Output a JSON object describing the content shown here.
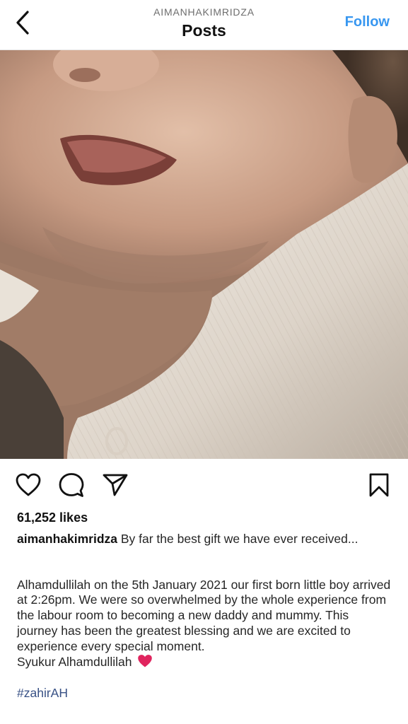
{
  "header": {
    "username": "AIMANHAKIMRIDZA",
    "title": "Posts",
    "follow_label": "Follow"
  },
  "icons": {
    "back": "chevron-left-icon",
    "like": "heart-outline-icon",
    "comment": "comment-bubble-icon",
    "share": "paper-plane-icon",
    "save": "bookmark-icon"
  },
  "post": {
    "image_alt": "Close-up of a smiling newborn baby wearing a white ribbed onesie",
    "likes": "61,252 likes",
    "caption_username": "aimanhakimridza",
    "caption_first": " By far the best gift we have ever received...",
    "caption_paragraph": " Alhamdullilah on the 5th January 2021 our first born little boy arrived at 2:26pm. We were so overwhelmed by the whole experience from the labour room to becoming a new daddy and mummy. This journey has been the greatest blessing and we are excited to experience every special moment.",
    "caption_syukur": "Syukur Alhamdullilah ",
    "hashtag": "#zahirAH"
  },
  "colors": {
    "accent": "#3897f0",
    "hashtag": "#385185",
    "heart_emoji": "#e0245e"
  }
}
